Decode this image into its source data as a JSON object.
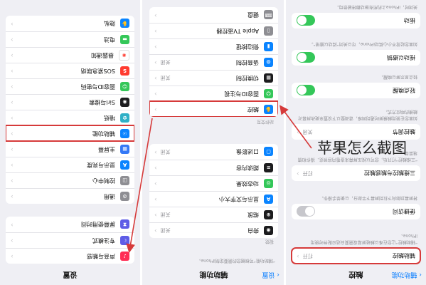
{
  "left": {
    "header": {
      "back": "辅助功能",
      "title": "触控"
    },
    "top_card": {
      "label": "辅助触控",
      "value": "打开"
    },
    "top_note": "“辅助触控”让您在难以触碰屏幕或需要自适应配件时使用iPhone。",
    "card2": {
      "label": "便捷访问",
      "on": false
    },
    "note2": "将屏幕顶部向下拉到屏幕下半部分，以便单手操作。",
    "card3": {
      "label": "三维触控与触感触控",
      "value": "打开"
    },
    "note3": "“三维触控”打开后，您可以按压屏幕来查看内容预览、操作和情境菜单。",
    "card4": {
      "label": "触控调节",
      "value": "关闭"
    },
    "note4": "如果您在使用触摸屏时遇到困难，请调整以下设置来更改屏幕对触摸的响应方式。",
    "card5": {
      "label": "轻点唤醒",
      "on": true
    },
    "note5": "轻点显示屏以唤醒。",
    "card6": {
      "label": "摇动以撤销",
      "on": true
    },
    "note6": "如果您经常不小心摇动iPhone，可以关闭“摇动以撤销”。",
    "card7": {
      "label": "振动",
      "on": true
    },
    "note7": "关闭时，iPhone上的所有振动都将被停用。"
  },
  "middle": {
    "header": {
      "back": "设置",
      "title": "辅助功能"
    },
    "intro": "“辅助功能”可根据您的需要定制iPhone。",
    "section_vision": "视觉",
    "vision": [
      {
        "label": "旁白",
        "value": "关闭",
        "icon": "voiceover-icon",
        "color": "#1c1c1e"
      },
      {
        "label": "缩放",
        "value": "关闭",
        "icon": "zoom-icon",
        "color": "#1c1c1e"
      },
      {
        "label": "显示与文字大小",
        "value": "",
        "icon": "text-size-icon",
        "color": "#0a84ff"
      },
      {
        "label": "动态效果",
        "value": "",
        "icon": "motion-icon",
        "color": "#34c759"
      },
      {
        "label": "朗读内容",
        "value": "",
        "icon": "speech-icon",
        "color": "#1c1c1e"
      },
      {
        "label": "口述影像",
        "value": "关闭",
        "icon": "audio-description-icon",
        "color": "#0a84ff"
      }
    ],
    "section_motor": "动作交互",
    "motor": [
      {
        "label": "触控",
        "value": "",
        "icon": "touch-icon",
        "color": "#0a84ff"
      },
      {
        "label": "面容ID与注视",
        "value": "",
        "icon": "face-id-icon",
        "color": "#34c759"
      },
      {
        "label": "切换控制",
        "value": "关闭",
        "icon": "switch-control-icon",
        "color": "#1c1c1e"
      },
      {
        "label": "语音控制",
        "value": "关闭",
        "icon": "voice-control-icon",
        "color": "#0a84ff"
      },
      {
        "label": "侧边按钮",
        "value": "",
        "icon": "side-button-icon",
        "color": "#0a84ff"
      },
      {
        "label": "Apple TV遥控器",
        "value": "",
        "icon": "apple-tv-remote-icon",
        "color": "#8e8e93"
      },
      {
        "label": "键盘",
        "value": "",
        "icon": "keyboard-icon",
        "color": "#8e8e93"
      }
    ]
  },
  "right": {
    "header": {
      "title": "设置"
    },
    "group1": [
      {
        "label": "声音与触感",
        "icon": "sound-icon",
        "color": "#ff2d55"
      },
      {
        "label": "专注模式",
        "icon": "focus-icon",
        "color": "#5e5ce6"
      },
      {
        "label": "屏幕使用时间",
        "icon": "screen-time-icon",
        "color": "#5e5ce6"
      }
    ],
    "group2": [
      {
        "label": "通用",
        "icon": "gear-icon",
        "color": "#8e8e93"
      },
      {
        "label": "控制中心",
        "icon": "control-center-icon",
        "color": "#8e8e93"
      },
      {
        "label": "显示与亮度",
        "icon": "display-icon",
        "color": "#0a84ff"
      },
      {
        "label": "主屏幕",
        "icon": "home-screen-icon",
        "color": "#3478f6"
      },
      {
        "label": "辅助功能",
        "icon": "accessibility-icon",
        "color": "#0a84ff"
      },
      {
        "label": "墙纸",
        "icon": "wallpaper-icon",
        "color": "#30b0c7"
      },
      {
        "label": "Siri与搜索",
        "icon": "siri-icon",
        "color": "#1c1c1e"
      },
      {
        "label": "面容ID与密码",
        "icon": "face-id-passcode-icon",
        "color": "#34c759"
      },
      {
        "label": "SOS紧急联络",
        "icon": "sos-icon",
        "color": "#ff3b30"
      },
      {
        "label": "暴露通知",
        "icon": "exposure-icon",
        "color": "#ffffff"
      },
      {
        "label": "电池",
        "icon": "battery-icon",
        "color": "#34c759"
      },
      {
        "label": "隐私",
        "icon": "privacy-icon",
        "color": "#0a84ff"
      }
    ]
  },
  "caption": "苹果怎么截图",
  "colors": {
    "highlight": "#d63a3a",
    "toggle_on": "#34c759",
    "background": "#efeff4"
  }
}
